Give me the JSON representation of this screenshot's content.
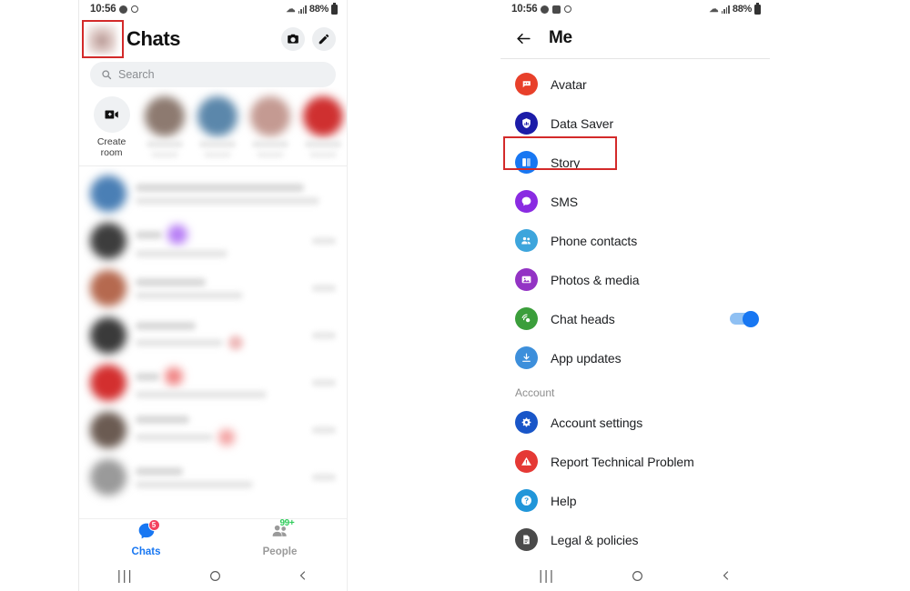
{
  "left_phone": {
    "status_bar": {
      "time": "10:56",
      "battery_percent": "88%",
      "icons": [
        "messenger-icon",
        "circle-slash-icon",
        "wifi-icon",
        "signal-icon",
        "battery-icon"
      ]
    },
    "header": {
      "title": "Chats",
      "avatar_name": "profile-avatar",
      "camera_label": "camera-icon",
      "compose_label": "compose-icon"
    },
    "search": {
      "placeholder": "Search",
      "icon": "search-icon"
    },
    "rooms": {
      "create_room_label_line1": "Create",
      "create_room_label_line2": "room",
      "create_room_icon": "video-plus-icon",
      "avatar_colors": [
        "#8d7a70",
        "#5b87ab",
        "#c49a92",
        "#cf3030"
      ]
    },
    "chat_rows": [
      {
        "avatar_color": "#4a7fb5"
      },
      {
        "avatar_color": "#3d3d3d"
      },
      {
        "avatar_color": "#b5694f"
      },
      {
        "avatar_color": "#3a3a3a"
      },
      {
        "avatar_color": "#d32f2f"
      },
      {
        "avatar_color": "#6b5b52"
      },
      {
        "avatar_color": "#9a9a9a"
      }
    ],
    "tabs": [
      {
        "label": "Chats",
        "badge": "5",
        "state": "active",
        "icon": "chat-bubble-icon"
      },
      {
        "label": "People",
        "badge": "99+",
        "state": "idle",
        "icon": "people-icon"
      }
    ],
    "nav": {
      "recents": "recents-icon",
      "home": "home-icon",
      "back": "back-icon"
    }
  },
  "right_phone": {
    "status_bar": {
      "time": "10:56",
      "battery_percent": "88%",
      "icons": [
        "messenger-icon",
        "image-icon",
        "circle-slash-icon",
        "wifi-icon",
        "signal-icon",
        "battery-icon"
      ]
    },
    "header": {
      "back_icon": "arrow-left-icon",
      "title": "Me"
    },
    "menu_items": [
      {
        "label": "Avatar",
        "icon": "avatar-icon",
        "color": "#e8402a",
        "toggle": null
      },
      {
        "label": "Data Saver",
        "icon": "data-saver-icon",
        "color": "#1c1ca8",
        "toggle": null
      },
      {
        "label": "Story",
        "icon": "story-icon",
        "color": "#1877f2",
        "toggle": null
      },
      {
        "label": "SMS",
        "icon": "sms-icon",
        "color": "#8a2be2",
        "toggle": null
      },
      {
        "label": "Phone contacts",
        "icon": "phone-contacts-icon",
        "color": "#3da5dc",
        "toggle": null
      },
      {
        "label": "Photos & media",
        "icon": "photos-media-icon",
        "color": "#9333c4",
        "toggle": null
      },
      {
        "label": "Chat heads",
        "icon": "chat-heads-icon",
        "color": "#3b9e3b",
        "toggle": "on"
      },
      {
        "label": "App updates",
        "icon": "app-updates-icon",
        "color": "#3d8fdb",
        "toggle": null
      }
    ],
    "account_section_label": "Account",
    "account_items": [
      {
        "label": "Account settings",
        "icon": "gear-icon",
        "color": "#1956c8"
      },
      {
        "label": "Report Technical Problem",
        "icon": "warning-icon",
        "color": "#e53935"
      },
      {
        "label": "Help",
        "icon": "help-icon",
        "color": "#2196d9"
      },
      {
        "label": "Legal & policies",
        "icon": "document-icon",
        "color": "#4a4a4a"
      }
    ],
    "nav": {
      "recents": "recents-icon",
      "home": "home-icon",
      "back": "back-icon"
    }
  },
  "annotations": {
    "highlight_color": "#d32a2a",
    "boxes": [
      {
        "target": "profile-avatar",
        "phone": "left"
      },
      {
        "target": "story-menu-item",
        "phone": "right"
      }
    ]
  }
}
